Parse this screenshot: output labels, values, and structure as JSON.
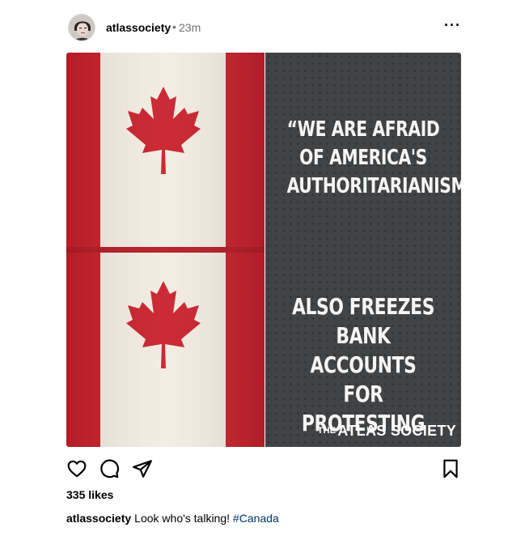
{
  "post": {
    "username": "atlassociety",
    "separator": "•",
    "time": "23m",
    "more_icon": "more-horizontal-icon",
    "image": {
      "quote": "“WE ARE AFRAID\nOF AMERICA'S\nAUTHORITARIANISM!”",
      "rebuttal": "ALSO FREEZES\nBANK ACCOUNTS\nFOR PROTESTING",
      "brand_the": "THE",
      "brand_name": "ATLAS SOCIETY",
      "colors": {
        "flag_red": "#c8202b",
        "flag_white": "#f3ece2",
        "panel": "#414345"
      }
    },
    "actions": [
      "heart-icon",
      "comment-icon",
      "share-icon",
      "bookmark-icon"
    ],
    "likes": "335 likes",
    "caption": {
      "username": "atlassociety",
      "text": "Look who's talking!",
      "hashtag": "#Canada"
    }
  }
}
